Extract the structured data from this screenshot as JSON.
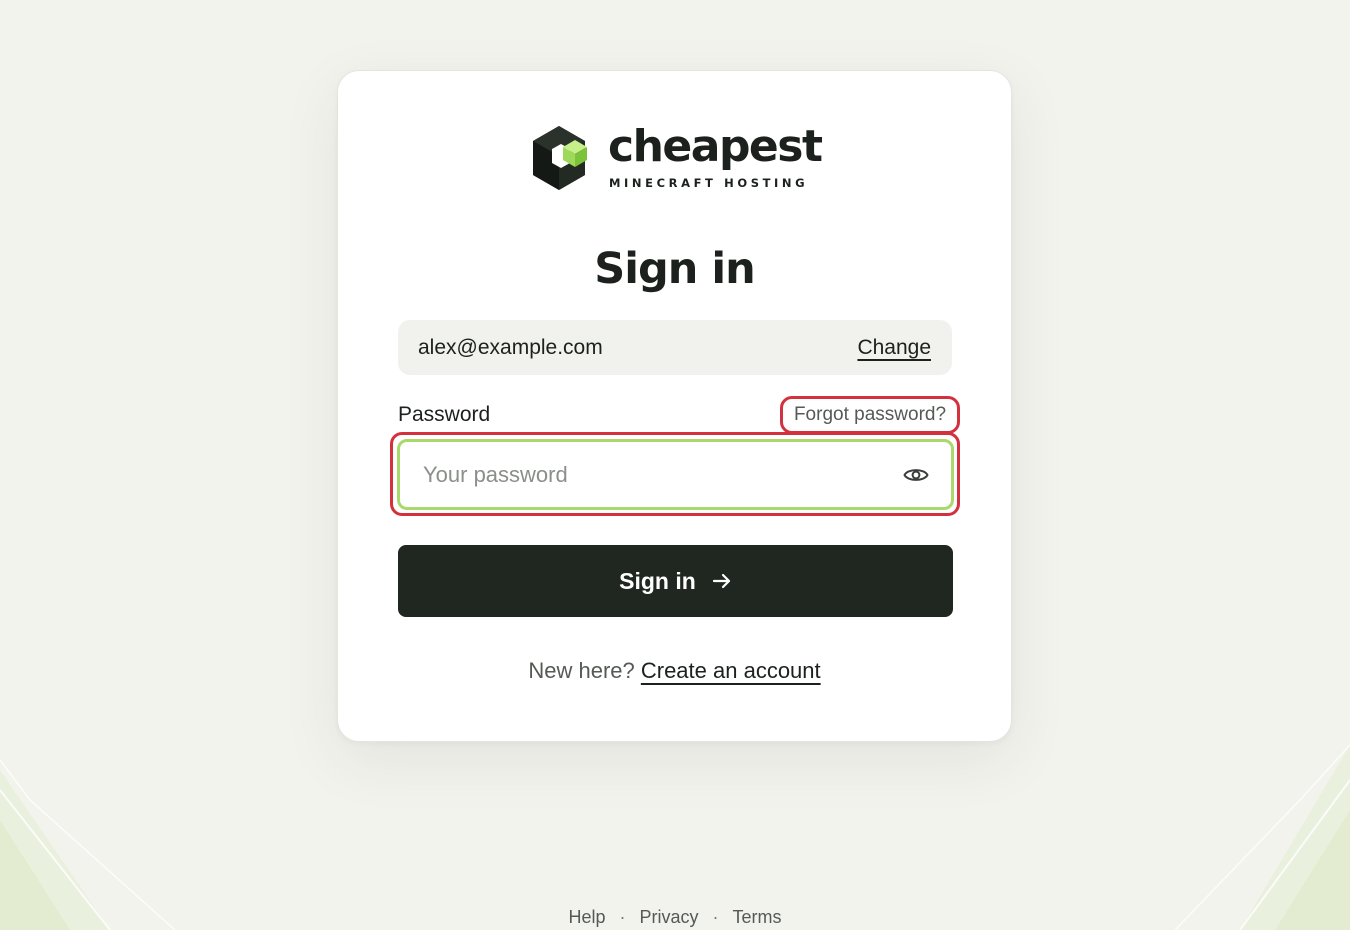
{
  "brand": {
    "name": "cheapest",
    "tagline": "MINECRAFT HOSTING",
    "colors": {
      "dark": "#1c211d",
      "accent_green": "#9ed95a",
      "button": "#202721",
      "focus_ring": "#a8d96a",
      "highlight_red": "#d4313f"
    }
  },
  "form": {
    "title": "Sign in",
    "email": {
      "value": "alex@example.com",
      "change_label": "Change"
    },
    "password": {
      "label": "Password",
      "forgot_label": "Forgot password?",
      "placeholder": "Your password",
      "value": "",
      "toggle_icon": "eye-icon"
    },
    "submit": {
      "label": "Sign in",
      "icon": "arrow-right-icon"
    },
    "signup": {
      "prompt": "New here?",
      "link_label": "Create an account"
    }
  },
  "footer": {
    "links": [
      "Help",
      "Privacy",
      "Terms"
    ],
    "separator": "·"
  }
}
